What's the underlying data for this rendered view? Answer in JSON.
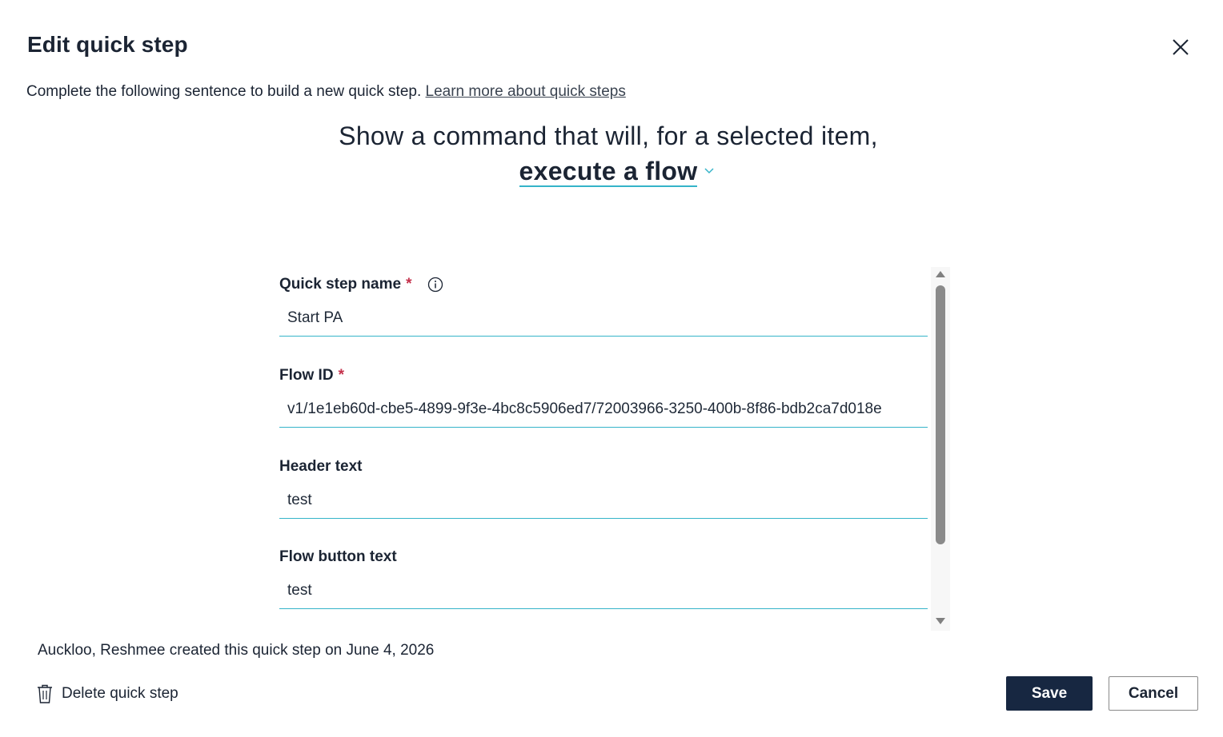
{
  "dialog": {
    "title": "Edit quick step",
    "close_icon": "close-icon"
  },
  "intro": {
    "text": "Complete the following sentence to build a new quick step.",
    "link_text": "Learn more about quick steps"
  },
  "sentence": {
    "prefix": "Show a command that will, for a selected item,",
    "action": "execute a flow",
    "action_chevron_icon": "chevron-down-icon"
  },
  "form": {
    "fields": [
      {
        "label": "Quick step name",
        "required": "*",
        "value": "Start PA",
        "info_icon": "info-icon"
      },
      {
        "label": "Flow ID",
        "required": "*",
        "value": "v1/1e1eb60d-cbe5-4899-9f3e-4bc8c5906ed7/72003966-3250-400b-8f86-bdb2ca7d018e"
      },
      {
        "label": "Header text",
        "value": "test"
      },
      {
        "label": "Flow button text",
        "value": "test"
      }
    ]
  },
  "footer": {
    "created_note": "Auckloo, Reshmee created this quick step on June 4, 2026",
    "delete_label": "Delete quick step",
    "delete_icon": "trash-icon",
    "save_label": "Save",
    "cancel_label": "Cancel"
  },
  "colors": {
    "accent_underline": "#35b4c9",
    "primary_button": "#172741",
    "required_star": "#c4314b"
  }
}
